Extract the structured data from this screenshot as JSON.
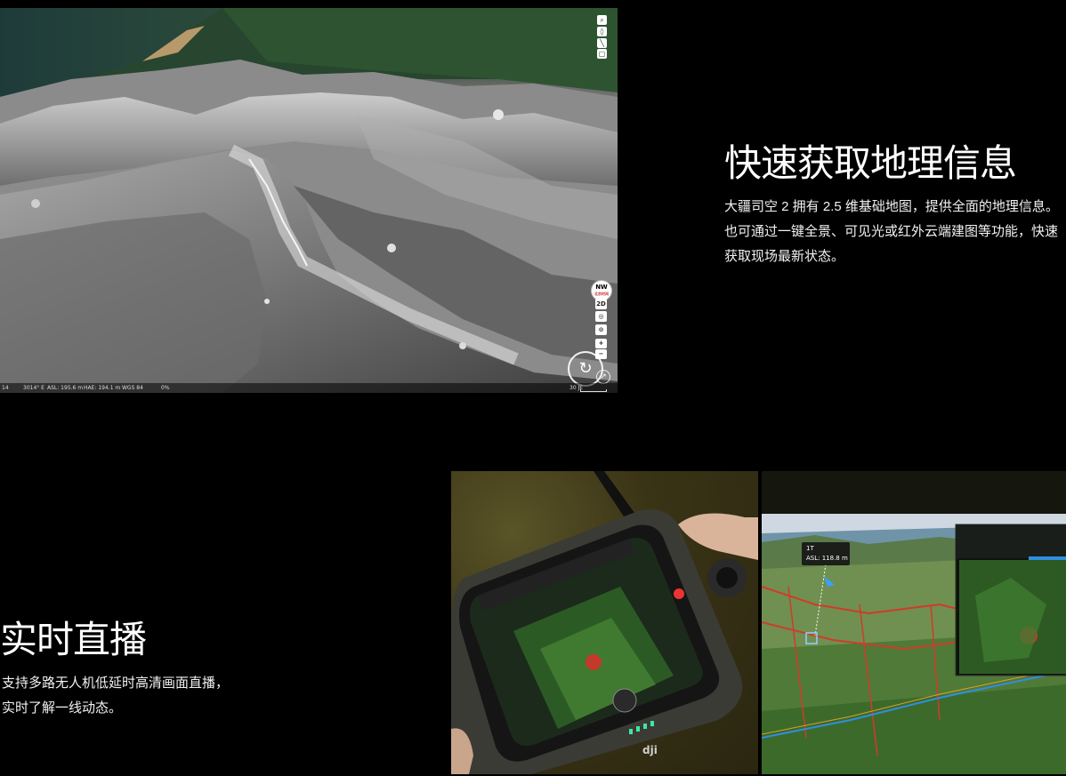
{
  "geo_section": {
    "title": "快速获取地理信息",
    "description": "大疆司空 2 拥有 2.5 维基础地图，提供全面的地理信息。也可通过一键全景、可见光或红外云端建图等功能，快速获取现场最新状态。"
  },
  "map_view": {
    "toolbar_icons": [
      "search-icon",
      "location-pin-icon",
      "measure-line-icon",
      "area-icon"
    ],
    "compass": {
      "direction": "NW",
      "sub_label": "北京时间"
    },
    "controls": {
      "view_mode": "2D",
      "zoom_in": "+",
      "zoom_out": "−"
    },
    "status_bar": {
      "coord_left": "14",
      "coord_right": "3014° E",
      "asl": "ASL: 195.6 m",
      "hae": "HAE: 194.1 m",
      "datum": "WGS 84",
      "percent": "0%",
      "scale": "30 JE"
    }
  },
  "live_section": {
    "title": "实时直播",
    "description_line1": "支持多路无人机低延时高清画面直播，",
    "description_line2": "实时了解一线动态。"
  },
  "screen_photo": {
    "label_top": "1T",
    "label_asl": "ASL: 118.8 m"
  },
  "colors": {
    "background": "#000000",
    "text": "#ffffff",
    "accent_blue": "#2f8ee0",
    "route_red": "#d23a2a"
  }
}
